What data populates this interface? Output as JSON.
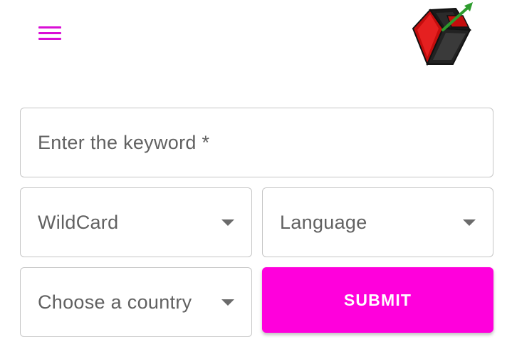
{
  "header": {
    "menu_icon": "hamburger-menu-icon",
    "logo_icon": "cube-logo-icon"
  },
  "form": {
    "keyword_placeholder": "Enter the keyword *",
    "wildcard_label": "WildCard",
    "language_label": "Language",
    "country_label": "Choose a country",
    "submit_label": "SUBMIT"
  },
  "colors": {
    "accent": "#ff00dc",
    "menu_icon": "#d90fd6",
    "field_border": "#c6c6c6",
    "field_text": "#616161"
  }
}
